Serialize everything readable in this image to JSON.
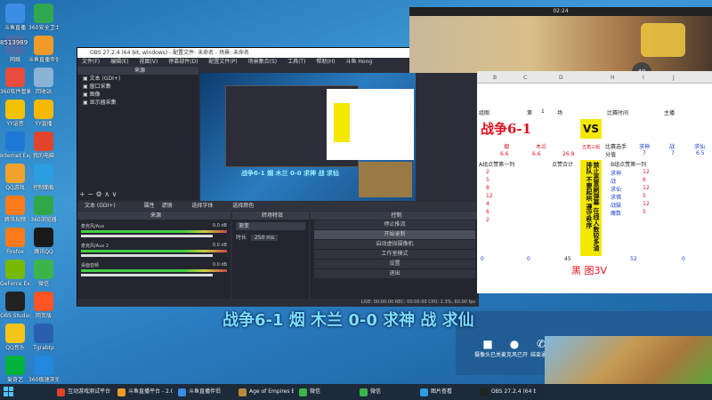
{
  "desktop_icons": [
    {
      "label": "斗鱼直播",
      "color": "#3a8ee6"
    },
    {
      "label": "360安全卫士",
      "color": "#2fa84f"
    },
    {
      "label": "网络",
      "color": "#4a6ea8"
    },
    {
      "label": "斗鱼直播伴侣",
      "color": "#f19a2a"
    },
    {
      "label": "360软件管家",
      "color": "#e84c3d"
    },
    {
      "label": "回收站",
      "color": "#8ab3d6"
    },
    {
      "label": "YY语音",
      "color": "#f2c200"
    },
    {
      "label": "YY直播",
      "color": "#f6b900"
    },
    {
      "label": "Internet Explorer",
      "color": "#1e78d6"
    },
    {
      "label": "我的电脑",
      "color": "#e0452b"
    },
    {
      "label": "QQ游戏",
      "color": "#f2a22b"
    },
    {
      "label": "控制面板",
      "color": "#2a9ee0"
    },
    {
      "label": "腾讯视频",
      "color": "#ff7a1a"
    },
    {
      "label": "360浏览器",
      "color": "#30a84a"
    },
    {
      "label": "Firefox",
      "color": "#ff7a1a"
    },
    {
      "label": "腾讯QQ",
      "color": "#1a1a1a"
    },
    {
      "label": "GeForce Experience",
      "color": "#76b900"
    },
    {
      "label": "微信",
      "color": "#3bb54a"
    },
    {
      "label": "OBS Studio",
      "color": "#222222"
    },
    {
      "label": "网页版",
      "color": "#ff5522"
    },
    {
      "label": "QQ音乐",
      "color": "#f5c518"
    },
    {
      "label": "Tgrabtp",
      "color": "#2a5fb0"
    },
    {
      "label": "爱奇艺",
      "color": "#00b33a"
    },
    {
      "label": "360极速浏览器",
      "color": "#2288dd"
    }
  ],
  "obs": {
    "title": "OBS 27.2.4 (64 bit, windows) - 配置文件: 未命名 - 场景: 未命名",
    "menu": [
      "文件(F)",
      "编辑(E)",
      "视图(V)",
      "停靠部件(D)",
      "配置文件(P)",
      "场景集合(S)",
      "工具(T)",
      "帮助(H)",
      "斗鱼 Hong"
    ],
    "sources_header": "来源",
    "sources": [
      "文本 (GDI+)",
      "窗口采集",
      "图像",
      "显示器采集"
    ],
    "transition_tab": "转场特效",
    "scene_tab": "来源",
    "controls_header": "控制",
    "controls": [
      "停止推流",
      "开始录制",
      "启动虚拟摄像机",
      "工作室模式",
      "设置",
      "退出"
    ],
    "transition_label": "渐变",
    "duration_label": "时长",
    "duration_value": "250 ms",
    "mixer": [
      {
        "name": "麦克风/Aux",
        "value": "0.0 dB"
      },
      {
        "name": "麦克风/Aux 2",
        "value": "0.0 dB"
      },
      {
        "name": "桌面音频",
        "value": "0.0 dB"
      }
    ],
    "status": "LIVE: 00:00:00   REC: 00:00:00   CPU: 1.3%, 60.00 fps",
    "props_label": "文本 (GDI+)",
    "props_tabs": [
      "属性",
      "滤镜",
      "选择字体",
      "选择颜色"
    ],
    "preview_caption": "战争6-1 烟 木兰 0-0 求神 战 求仙"
  },
  "sheet": {
    "title": "战争6-1",
    "vs": "VS",
    "row_labels": [
      "组图",
      "第",
      "1",
      "场"
    ],
    "match_time": "比赛时间",
    "host": "主播",
    "cols_top": [
      "B",
      "C",
      "D",
      "H",
      "I",
      "J"
    ],
    "left_vals": [
      "6.6",
      "6.6",
      "26.8"
    ],
    "left_names": [
      "烟",
      "木兰"
    ],
    "right_header": [
      "比赛选手",
      "求神",
      "战",
      "求仙"
    ],
    "right_score": [
      "分值",
      "7",
      "7",
      "6.5"
    ],
    "a_group": "A组点赞第一列",
    "b_group": "B组点赞第一列",
    "point_total": "点赞合计",
    "left_counts": [
      "2",
      "5",
      "8",
      "12",
      "4",
      "6",
      "2"
    ],
    "right_names": [
      "求神",
      "战",
      "求仙",
      "求佛",
      "战鼓",
      "魔数"
    ],
    "right_counts": [
      "12",
      "6",
      "12",
      "5",
      "12",
      "5"
    ],
    "bottom_vals": [
      "0",
      "0",
      "45",
      "黑   图3V",
      "52",
      "0"
    ],
    "vertical_note": "禁止恶意刷弹幕 在线人数较多请排队 不要起哄 遵守秩序",
    "side_note": "五角三组"
  },
  "video_call": {
    "time": "02:24",
    "badge": "40",
    "buttons": [
      "摄像头已关",
      "麦克风已开",
      "结束通话"
    ]
  },
  "overlay_caption": "战争6-1 烟 木兰 0-0 求神 战 求仙",
  "taskbar": [
    {
      "label": "互动游戏测试平台",
      "color": "#e0452b"
    },
    {
      "label": "斗鱼直播平台 - 2.0...",
      "color": "#f19a2a"
    },
    {
      "label": "斗鱼直播伴侣",
      "color": "#3a8ee6"
    },
    {
      "label": "Age of Empires E...",
      "color": "#b58a3a"
    },
    {
      "label": "微信",
      "color": "#3bb54a"
    },
    {
      "label": "微信",
      "color": "#3bb54a"
    },
    {
      "label": "图片查看",
      "color": "#2a9ee0"
    },
    {
      "label": "OBS 27.2.4 (64 bi...",
      "color": "#222222"
    }
  ],
  "user_count": "8513989"
}
